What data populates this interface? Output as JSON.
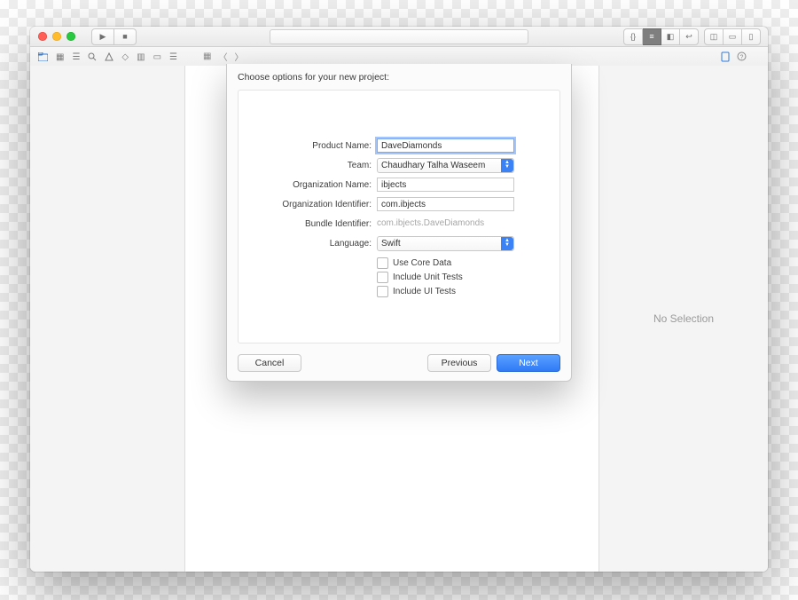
{
  "toolbar": {
    "run_icon": "▶",
    "stop_icon": "■",
    "right_group_a": [
      "{}",
      "≡",
      "◧",
      "↩"
    ],
    "right_group_b": [
      "◫",
      "▭",
      "▯"
    ]
  },
  "navigator_icons": [
    "folder",
    "grid",
    "hierarchy",
    "search",
    "warning",
    "tag",
    "debug",
    "breakpoint",
    "report"
  ],
  "editor_jump": [
    "grid",
    "back",
    "forward"
  ],
  "inspector_icons": [
    "file",
    "help"
  ],
  "inspector": {
    "placeholder": "No Selection"
  },
  "sheet": {
    "title": "Choose options for your new project:",
    "rows": {
      "product_name": {
        "label": "Product Name:",
        "value": "DaveDiamonds"
      },
      "team": {
        "label": "Team:",
        "value": "Chaudhary Talha Waseem"
      },
      "org_name": {
        "label": "Organization Name:",
        "value": "ibjects"
      },
      "org_id": {
        "label": "Organization Identifier:",
        "value": "com.ibjects"
      },
      "bundle_id": {
        "label": "Bundle Identifier:",
        "value": "com.ibjects.DaveDiamonds"
      },
      "language": {
        "label": "Language:",
        "value": "Swift"
      }
    },
    "checks": {
      "core_data": "Use Core Data",
      "unit_tests": "Include Unit Tests",
      "ui_tests": "Include UI Tests"
    },
    "buttons": {
      "cancel": "Cancel",
      "previous": "Previous",
      "next": "Next"
    }
  }
}
